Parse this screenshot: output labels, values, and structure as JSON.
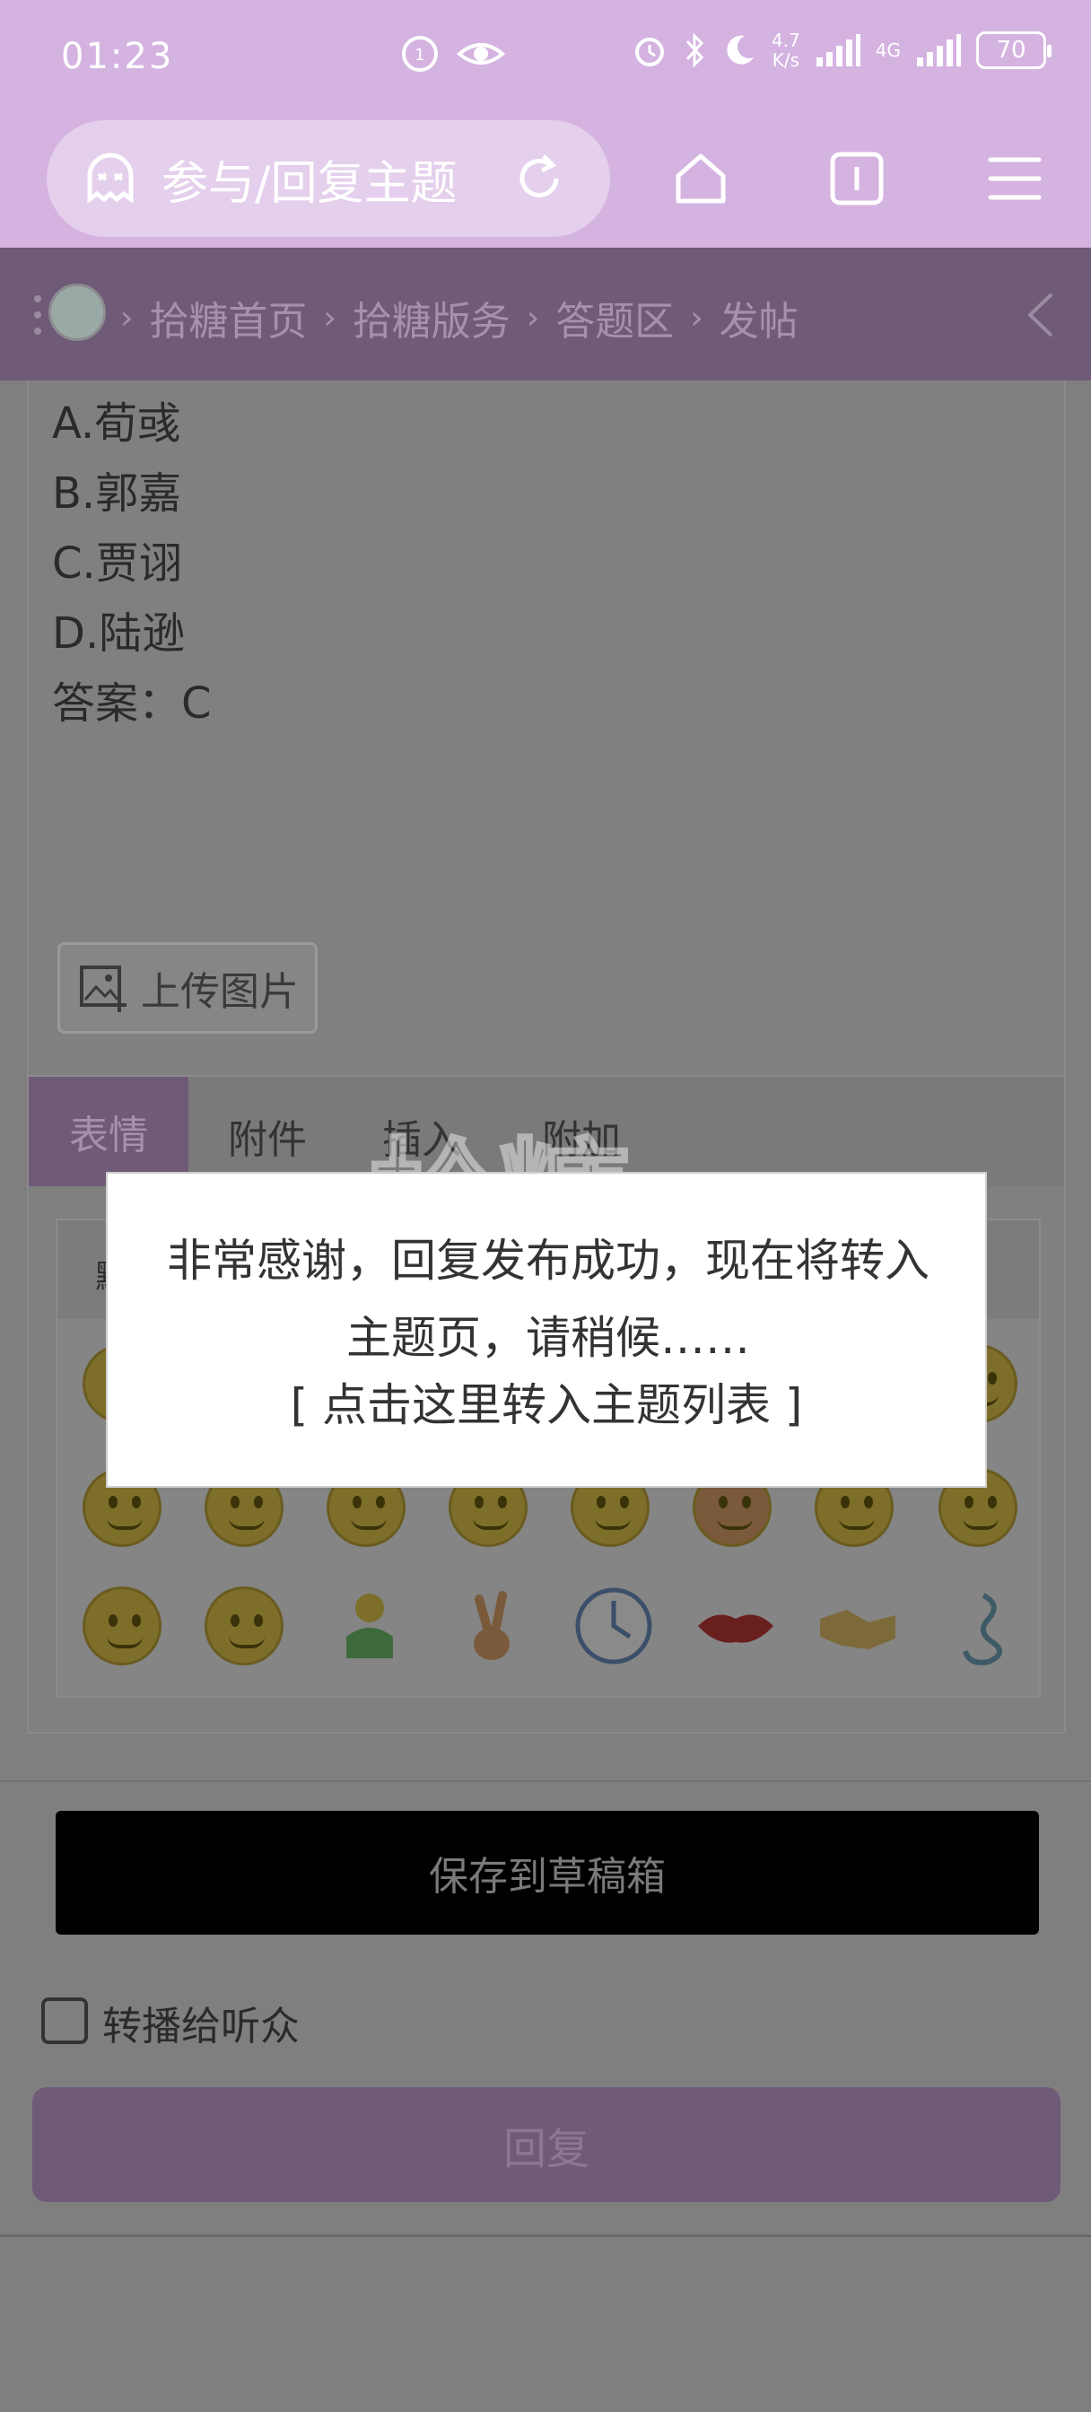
{
  "status_bar": {
    "time": "01:23",
    "net_speed_top": "4.7",
    "net_speed_bottom": "K/s",
    "network": "4G",
    "battery": "70"
  },
  "browser": {
    "url_text": "参与/回复主题",
    "icons": [
      "ghost-icon",
      "reload-icon",
      "home-icon",
      "tabs-icon",
      "menu-icon"
    ]
  },
  "breadcrumb": {
    "items": [
      "拾糖首页",
      "拾糖版务",
      "答题区",
      "发帖"
    ]
  },
  "editor": {
    "lines": [
      "A.荀彧",
      "B.郭嘉",
      "C.贾诩",
      "D.陆逊",
      "答案：C"
    ],
    "upload_label": "上传图片"
  },
  "tabs": {
    "items": [
      "表情",
      "附件",
      "插入",
      "附加"
    ],
    "active": "表情"
  },
  "smilies_header_label": "默",
  "watermark": "拾糖",
  "actions": {
    "save_draft": "保存到草稿箱",
    "broadcast_label": "转播给听众",
    "reply": "回复"
  },
  "modal": {
    "message_line1": "非常感谢，回复发布成功，现在将转入",
    "message_line2": "主题页，请稍候……",
    "link": "[ 点击这里转入主题列表 ]"
  }
}
